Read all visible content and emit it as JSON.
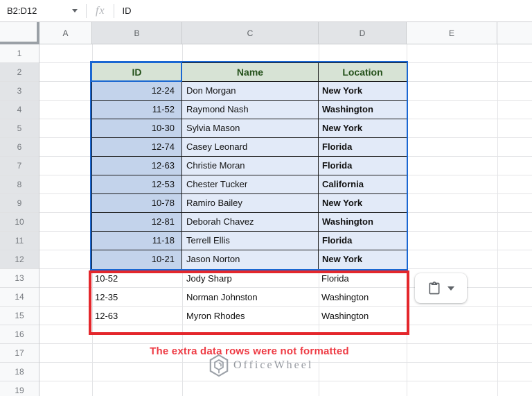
{
  "formula_bar": {
    "name_box": "B2:D12",
    "fx_label": "fx",
    "value": "ID"
  },
  "grid": {
    "col_labels": [
      "A",
      "B",
      "C",
      "D",
      "E",
      ""
    ],
    "row_labels": [
      "1",
      "2",
      "3",
      "4",
      "5",
      "6",
      "7",
      "8",
      "9",
      "10",
      "11",
      "12",
      "13",
      "14",
      "15",
      "16",
      "17",
      "18",
      "19"
    ]
  },
  "table": {
    "headers": [
      "ID",
      "Name",
      "Location"
    ],
    "rows": [
      [
        "12-24",
        "Don Morgan",
        "New York"
      ],
      [
        "11-52",
        "Raymond Nash",
        "Washington"
      ],
      [
        "10-30",
        "Sylvia Mason",
        "New York"
      ],
      [
        "12-74",
        "Casey Leonard",
        "Florida"
      ],
      [
        "12-63",
        "Christie Moran",
        "Florida"
      ],
      [
        "12-53",
        "Chester Tucker",
        "California"
      ],
      [
        "10-78",
        "Ramiro Bailey",
        "New York"
      ],
      [
        "12-81",
        "Deborah Chavez",
        "Washington"
      ],
      [
        "11-18",
        "Terrell Ellis",
        "Florida"
      ],
      [
        "10-21",
        "Jason Norton",
        "New York"
      ]
    ]
  },
  "plain_rows": [
    [
      "10-52",
      "Jody Sharp",
      "Florida"
    ],
    [
      "12-35",
      "Norman Johnston",
      "Washington"
    ],
    [
      "12-63",
      "Myron Rhodes",
      "Washington"
    ]
  ],
  "annotation": {
    "text": "The extra data rows were not formatted"
  },
  "watermark": {
    "text": "OfficeWheel"
  },
  "colors": {
    "selection_blue": "#1a67d2",
    "annotation_red": "#e4272c",
    "header_green_bg": "#d7e3d5",
    "header_green_text": "#24511a",
    "id_column_bg": "#c3d3eb",
    "data_cell_bg": "#e2eaf8"
  }
}
